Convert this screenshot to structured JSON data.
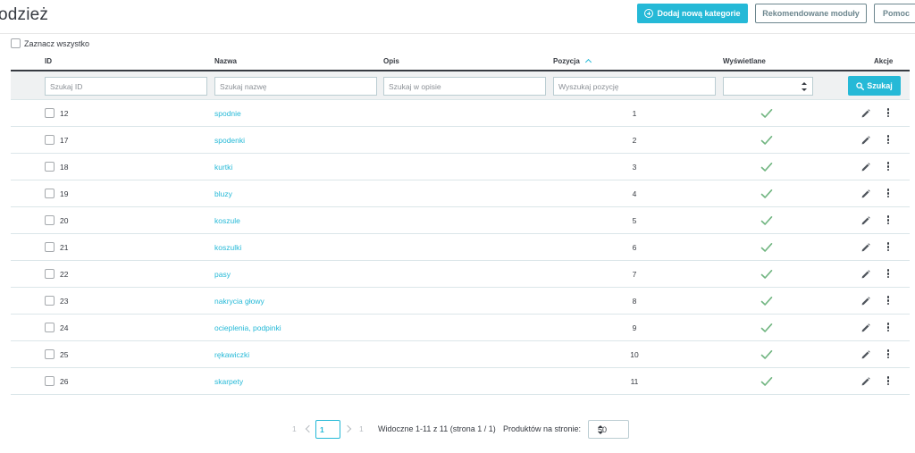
{
  "header": {
    "title": "odzież",
    "add_category_label": "Dodaj nową kategorie",
    "recommended_modules_label": "Rekomendowane moduły",
    "help_label": "Pomoc"
  },
  "bulk": {
    "select_all_label": "Zaznacz wszystko"
  },
  "table": {
    "columns": {
      "id": "ID",
      "name": "Nazwa",
      "description": "Opis",
      "position": "Pozycja",
      "displayed": "Wyświetlane",
      "actions": "Akcje"
    },
    "filters": {
      "id_placeholder": "Szukaj ID",
      "name_placeholder": "Szukaj nazwę",
      "description_placeholder": "Szukaj w opisie",
      "position_placeholder": "Wyszukaj pozycję",
      "displayed_value": "",
      "search_label": "Szukaj"
    },
    "rows": [
      {
        "id": "12",
        "name": "spodnie",
        "position": "1",
        "displayed": true
      },
      {
        "id": "17",
        "name": "spodenki",
        "position": "2",
        "displayed": true
      },
      {
        "id": "18",
        "name": "kurtki",
        "position": "3",
        "displayed": true
      },
      {
        "id": "19",
        "name": "bluzy",
        "position": "4",
        "displayed": true
      },
      {
        "id": "20",
        "name": "koszule",
        "position": "5",
        "displayed": true
      },
      {
        "id": "21",
        "name": "koszulki",
        "position": "6",
        "displayed": true
      },
      {
        "id": "22",
        "name": "pasy",
        "position": "7",
        "displayed": true
      },
      {
        "id": "23",
        "name": "nakrycia głowy",
        "position": "8",
        "displayed": true
      },
      {
        "id": "24",
        "name": "ocieplenia, podpinki",
        "position": "9",
        "displayed": true
      },
      {
        "id": "25",
        "name": "rękawiczki",
        "position": "10",
        "displayed": true
      },
      {
        "id": "26",
        "name": "skarpety",
        "position": "11",
        "displayed": true
      }
    ]
  },
  "pagination": {
    "first_page": "1",
    "current_page": "1",
    "last_page": "1",
    "visible_info": "Widoczne 1-11 z 11 (strona 1 / 1)",
    "per_page_label": "Produktów na stronie:",
    "per_page_value": "50"
  },
  "colors": {
    "accent": "#25b9d7",
    "text": "#363a41",
    "check": "#70b580"
  },
  "icons": {
    "add": "plus-circle-icon",
    "search": "search-icon",
    "sort": "chevron-up-icon",
    "displayed": "check-icon",
    "edit": "pencil-icon",
    "more": "more-vertical-icon"
  }
}
